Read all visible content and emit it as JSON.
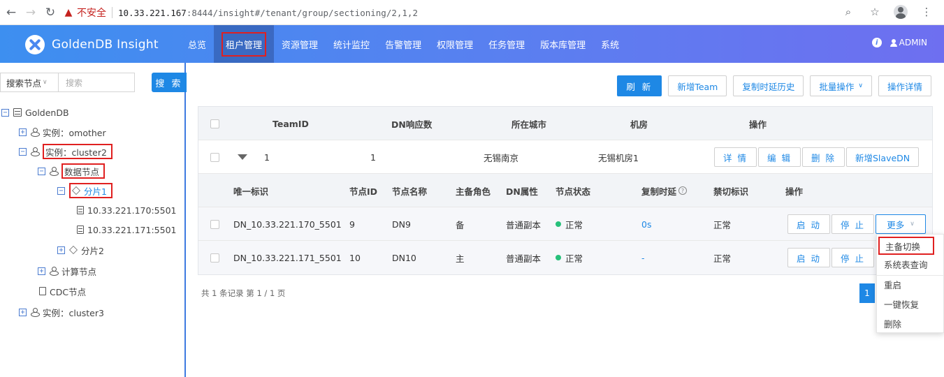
{
  "browser": {
    "insecure_label": "不安全",
    "url_host": "10.33.221.167",
    "url_rest": ":8444/insight#/tenant/group/sectioning/2,1,2"
  },
  "app": {
    "logo_text": "GoldenDB Insight",
    "menu": [
      {
        "label": "总览"
      },
      {
        "label": "租户管理"
      },
      {
        "label": "资源管理"
      },
      {
        "label": "统计监控"
      },
      {
        "label": "告警管理"
      },
      {
        "label": "权限管理"
      },
      {
        "label": "任务管理"
      },
      {
        "label": "版本库管理"
      },
      {
        "label": "系统"
      }
    ],
    "user": "ADMIN"
  },
  "sidebar": {
    "search_select": "搜索节点",
    "search_placeholder": "搜索",
    "search_button": "搜 索",
    "tree": {
      "root": "GoldenDB",
      "inst1": "实例：omother",
      "inst2": "实例：cluster2",
      "data_node": "数据节点",
      "shard1": "分片1",
      "host1": "10.33.221.170:5501",
      "host2": "10.33.221.171:5501",
      "shard2": "分片2",
      "compute_node": "计算节点",
      "cdc_node": "CDC节点",
      "inst3": "实例：cluster3"
    }
  },
  "toolbar": {
    "refresh": "刷 新",
    "add_team": "新增Team",
    "copy_history": "复制时延历史",
    "batch": "批量操作",
    "op_detail": "操作详情"
  },
  "team_table": {
    "headers": {
      "team_id": "TeamID",
      "dn_count": "DN响应数",
      "city": "所在城市",
      "room": "机房",
      "ops": "操作"
    },
    "row": {
      "team_id": "1",
      "dn_count": "1",
      "city": "无锡南京",
      "room": "无锡机房1"
    },
    "row_buttons": {
      "detail": "详 情",
      "edit": "编 辑",
      "delete": "删 除",
      "add_slave": "新增SlaveDN"
    }
  },
  "dn_table": {
    "headers": {
      "uid": "唯一标识",
      "node_id": "节点ID",
      "node_name": "节点名称",
      "role": "主备角色",
      "attr": "DN属性",
      "status": "节点状态",
      "delay": "复制时延",
      "cutover": "禁切标识",
      "ops": "操作"
    },
    "rows": [
      {
        "uid": "DN_10.33.221.170_5501",
        "node_id": "9",
        "node_name": "DN9",
        "role": "备",
        "attr": "普通副本",
        "status": "正常",
        "delay": "0s",
        "cutover": "正常"
      },
      {
        "uid": "DN_10.33.221.171_5501",
        "node_id": "10",
        "node_name": "DN10",
        "role": "主",
        "attr": "普通副本",
        "status": "正常",
        "delay": "-",
        "cutover": "正常"
      }
    ],
    "btn_start": "启 动",
    "btn_stop": "停 止",
    "btn_more": "更多"
  },
  "pager": {
    "summary": "共 1 条记录  第 1 / 1 页",
    "current": "1"
  },
  "dropdown": {
    "items": [
      "主备切换",
      "系统表查询",
      "重启",
      "一键恢复",
      "删除"
    ]
  },
  "colors": {
    "primary": "#1e88e5",
    "highlight": "#e02020",
    "status_ok": "#27c07a"
  }
}
